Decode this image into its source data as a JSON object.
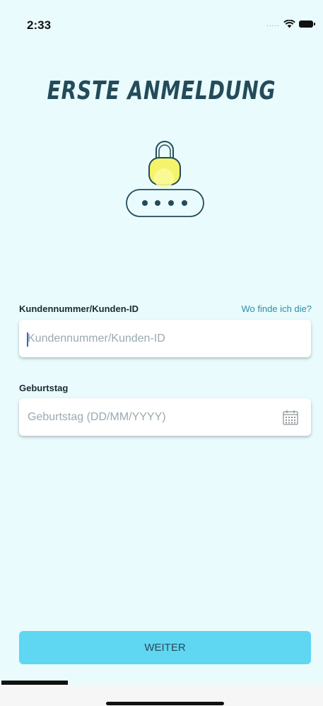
{
  "status_bar": {
    "time": "2:33",
    "signal": "....."
  },
  "title": "ERSTE ANMELDUNG",
  "customer_id": {
    "label": "Kundennummer/Kunden-ID",
    "help_link": "Wo finde ich die?",
    "placeholder": "Kundennummer/Kunden-ID",
    "value": ""
  },
  "birthday": {
    "label": "Geburtstag",
    "placeholder": "Geburtstag (DD/MM/YYYY)",
    "value": "",
    "icon": "calendar-icon"
  },
  "submit_label": "WEITER",
  "colors": {
    "background": "#e9fbfd",
    "title": "#234b5a",
    "lock_fill": "#f4f36a",
    "link": "#2a8fa6",
    "button": "#5fd6f2"
  },
  "icons": {
    "lock": "lock-icon",
    "password_dots": "password-dots-icon",
    "wifi": "wifi-icon",
    "battery": "battery-icon"
  }
}
